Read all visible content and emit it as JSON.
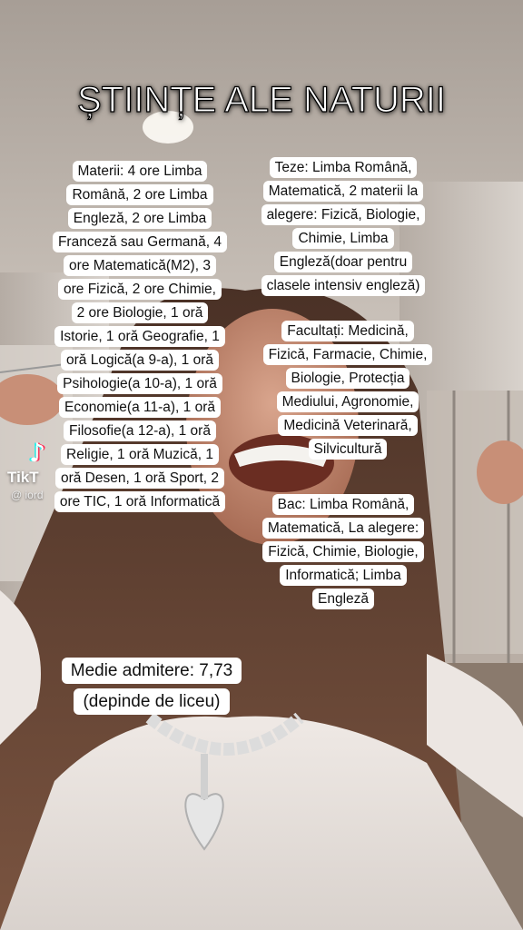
{
  "title": "ȘTIINȚE ALE NATURII",
  "captions": {
    "materii": [
      "Materii: 4 ore Limba",
      "Română, 2 ore Limba",
      "Engleză, 2 ore Limba",
      "Franceză sau Germană, 4",
      "ore Matematică(M2), 3",
      "ore Fizică, 2 ore Chimie,",
      "2 ore Biologie, 1 oră",
      "Istorie, 1 oră Geografie, 1",
      "oră Logică(a 9-a), 1 oră",
      "Psihologie(a 10-a), 1 oră",
      "Economie(a 11-a), 1 oră",
      "Filosofie(a 12-a), 1 oră",
      "Religie, 1 oră Muzică, 1",
      "oră Desen, 1 oră Sport, 2",
      "ore TIC, 1 oră Informatică"
    ],
    "teze": [
      "Teze: Limba Română,",
      "Matematică, 2 materii la",
      "alegere: Fizică, Biologie,",
      "Chimie, Limba",
      "Engleză(doar pentru",
      "clasele intensiv engleză)"
    ],
    "facultati": [
      "Facultați: Medicină,",
      "Fizică, Farmacie, Chimie,",
      "Biologie, Protecția",
      "Mediului, Agronomie,",
      "Medicină Veterinară,",
      "Silvicultură"
    ],
    "bac": [
      "Bac: Limba Română,",
      "Matematică, La alegere:",
      "Fizică, Chimie, Biologie,",
      "Informatică; Limba",
      "Engleză"
    ],
    "medie": [
      "Medie admitere: 7,73",
      "(depinde de liceu)"
    ]
  },
  "watermark": {
    "brand": "TikT",
    "handle": "@ iord",
    "icon": "tiktok-note-icon"
  },
  "colors": {
    "caption_bg": "#ffffff",
    "title_text": "#ffffff"
  }
}
